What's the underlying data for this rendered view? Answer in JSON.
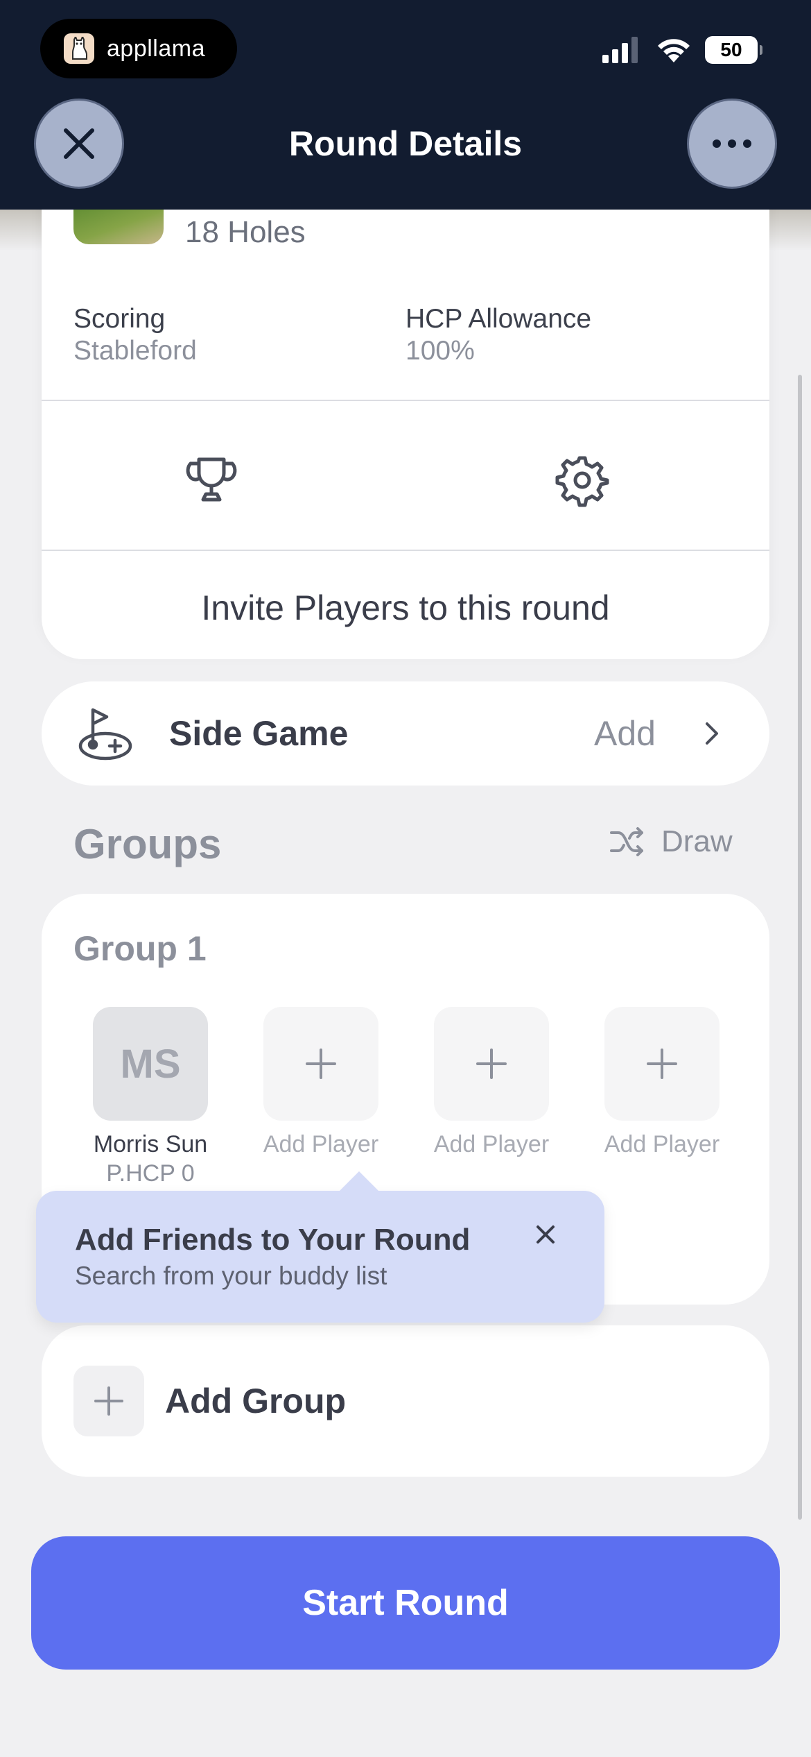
{
  "status_bar": {
    "app_pill_text": "appllama",
    "battery": "50",
    "icons": [
      "cellular-signal-icon",
      "wifi-icon",
      "battery-icon"
    ]
  },
  "header": {
    "title": "Round Details",
    "close_icon": "close-icon",
    "more_icon": "more-icon"
  },
  "course": {
    "holes": "18 Holes",
    "scoring_label": "Scoring",
    "scoring_value": "Stableford",
    "hcp_label": "HCP Allowance",
    "hcp_value": "100%",
    "invite_text": "Invite Players to this round"
  },
  "side_game": {
    "title": "Side Game",
    "action": "Add"
  },
  "groups": {
    "title": "Groups",
    "draw_label": "Draw",
    "group_name": "Group 1",
    "player": {
      "initials": "MS",
      "name": "Morris Sun",
      "hcp": "P.HCP 0"
    },
    "empty_slots": [
      "Add Player",
      "Add Player",
      "Add Player"
    ]
  },
  "tooltip": {
    "title": "Add Friends to Your Round",
    "subtitle": "Search from your buddy list"
  },
  "add_group_label": "Add Group",
  "start_button": "Start Round",
  "colors": {
    "header_bg": "#121c30",
    "accent": "#5c6ff0",
    "tooltip_bg": "#d5dcf8"
  }
}
